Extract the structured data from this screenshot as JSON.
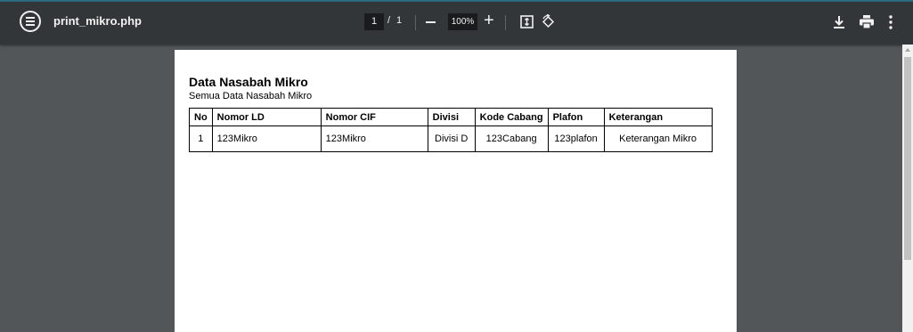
{
  "toolbar": {
    "file_name": "print_mikro.php",
    "current_page": "1",
    "page_separator": "/",
    "total_pages": "1",
    "zoom_level": "100%",
    "zoom_out_label": "—",
    "zoom_in_label": "+",
    "icons": [
      "menu-icon",
      "fit-to-page-icon",
      "rotate-icon",
      "download-icon",
      "print-icon",
      "more-options-icon"
    ]
  },
  "document": {
    "title": "Data Nasabah Mikro",
    "subtitle": "Semua Data Nasabah Mikro",
    "table": {
      "headers": [
        "No",
        "Nomor LD",
        "Nomor CIF",
        "Divisi",
        "Kode Cabang",
        "Plafon",
        "Keterangan"
      ],
      "rows": [
        [
          "1",
          "123Mikro",
          "123Mikro",
          "Divisi D",
          "123Cabang",
          "123plafon",
          "Keterangan Mikro"
        ]
      ]
    }
  },
  "colors": {
    "toolbar_bg": "#323639",
    "viewer_bg": "#525659",
    "accent_line": "#2f6f86",
    "page_bg": "#ffffff"
  }
}
